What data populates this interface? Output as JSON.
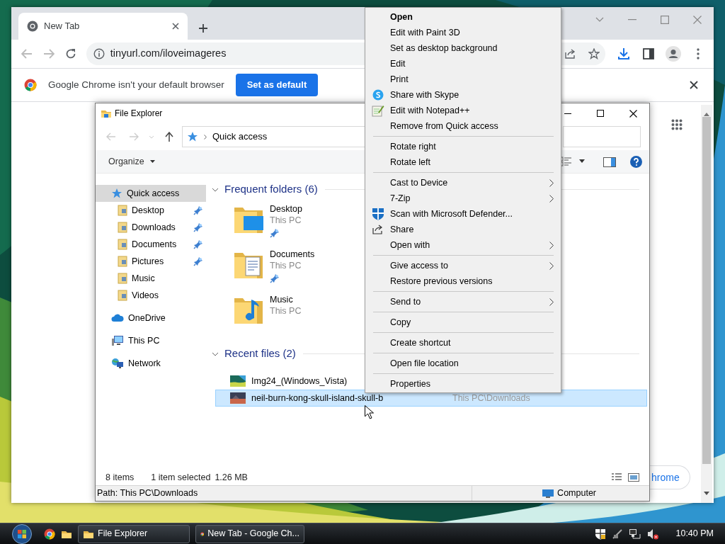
{
  "browser": {
    "tabs": [
      {
        "label": "New Tab",
        "selected": true
      }
    ],
    "address": "tinyurl.com/iloveimageres",
    "infobar": {
      "message": "Google Chrome isn't your default browser",
      "button": "Set as default"
    },
    "customize_button": "hrome"
  },
  "explorer": {
    "title": "File Explorer",
    "address": "Quick access",
    "toolbar": {
      "organize": "Organize"
    },
    "nav": [
      {
        "label": "Quick access",
        "selected": true,
        "children": [
          {
            "label": "Desktop",
            "pinned": true
          },
          {
            "label": "Downloads",
            "pinned": true
          },
          {
            "label": "Documents",
            "pinned": true
          },
          {
            "label": "Pictures",
            "pinned": true
          },
          {
            "label": "Music",
            "pinned": false
          },
          {
            "label": "Videos",
            "pinned": false
          }
        ]
      },
      {
        "label": "OneDrive",
        "selected": false
      },
      {
        "label": "This PC",
        "selected": false
      },
      {
        "label": "Network",
        "selected": false
      }
    ],
    "frequent_folders": {
      "heading": "Frequent folders (6)",
      "expanded": true,
      "items": [
        {
          "name": "Desktop",
          "location": "This PC",
          "pinned": true
        },
        {
          "name": "Documents",
          "location": "This PC",
          "pinned": true
        },
        {
          "name": "Music",
          "location": "This PC",
          "pinned": false
        }
      ]
    },
    "recent_files": {
      "heading": "Recent files (2)",
      "expanded": true,
      "items": [
        {
          "name": "Img24_(Windows_Vista)",
          "selected": false
        },
        {
          "name": "neil-burn-kong-skull-island-skull-b",
          "location": "This PC\\Downloads",
          "selected": true
        }
      ]
    },
    "status": {
      "count": "8 items",
      "selection": "1 item selected",
      "size": "1.26 MB"
    },
    "details": {
      "path": "Path: This PC\\Downloads",
      "zone": "Computer"
    }
  },
  "context_menu": {
    "groups": [
      [
        {
          "label": "Open",
          "kind": "default",
          "submenu": false
        },
        {
          "label": "Edit with Paint 3D",
          "kind": "plain",
          "submenu": false
        },
        {
          "label": "Set as desktop background",
          "kind": "plain",
          "submenu": false
        },
        {
          "label": "Edit",
          "kind": "plain",
          "submenu": false
        },
        {
          "label": "Print",
          "kind": "plain",
          "submenu": false
        },
        {
          "label": "Share with Skype",
          "kind": "plain",
          "submenu": false
        },
        {
          "label": "Edit with Notepad++",
          "kind": "plain",
          "submenu": false
        },
        {
          "label": "Remove from Quick access",
          "kind": "plain",
          "submenu": false
        }
      ],
      [
        {
          "label": "Rotate right",
          "kind": "plain",
          "submenu": false
        },
        {
          "label": "Rotate left",
          "kind": "plain",
          "submenu": false
        }
      ],
      [
        {
          "label": "Cast to Device",
          "kind": "plain",
          "submenu": true
        },
        {
          "label": "7-Zip",
          "kind": "plain",
          "submenu": true
        },
        {
          "label": "Scan with Microsoft Defender...",
          "kind": "plain",
          "submenu": false
        },
        {
          "label": "Share",
          "kind": "plain",
          "submenu": false
        },
        {
          "label": "Open with",
          "kind": "plain",
          "submenu": true
        }
      ],
      [
        {
          "label": "Give access to",
          "kind": "plain",
          "submenu": true
        },
        {
          "label": "Restore previous versions",
          "kind": "plain",
          "submenu": false
        }
      ],
      [
        {
          "label": "Send to",
          "kind": "plain",
          "submenu": true
        }
      ],
      [
        {
          "label": "Copy",
          "kind": "plain",
          "submenu": false
        }
      ],
      [
        {
          "label": "Create shortcut",
          "kind": "plain",
          "submenu": false
        }
      ],
      [
        {
          "label": "Open file location",
          "kind": "plain",
          "submenu": false
        }
      ],
      [
        {
          "label": "Properties",
          "kind": "plain",
          "submenu": false
        }
      ]
    ]
  },
  "taskbar": {
    "tasks": [
      {
        "label": "File Explorer"
      },
      {
        "label": "New Tab - Google Ch..."
      }
    ],
    "clock": "10:40 PM"
  }
}
